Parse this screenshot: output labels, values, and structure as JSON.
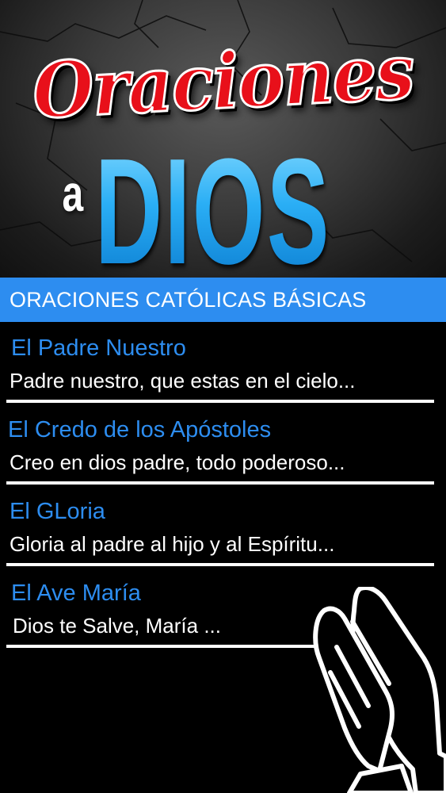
{
  "header": {
    "logo_line1": "Oraciones",
    "logo_connector": "a",
    "logo_line2": "DIOS"
  },
  "section": {
    "title": "ORACIONES CATÓLICAS BÁSICAS"
  },
  "prayers": [
    {
      "title": "El Padre Nuestro",
      "preview": "Padre nuestro, que estas en el cielo..."
    },
    {
      "title": "El Credo de los Apóstoles",
      "preview": "Creo en dios padre, todo poderoso..."
    },
    {
      "title": "El GLoria",
      "preview": "Gloria al padre al hijo y al Espíritu..."
    },
    {
      "title": "El Ave María",
      "preview": "Dios te Salve, María ..."
    }
  ],
  "decoration": {
    "icon": "praying-hands-icon"
  },
  "colors": {
    "accent_blue": "#2d8df0",
    "logo_red": "#e8101a",
    "background": "#000000",
    "text": "#ffffff"
  }
}
